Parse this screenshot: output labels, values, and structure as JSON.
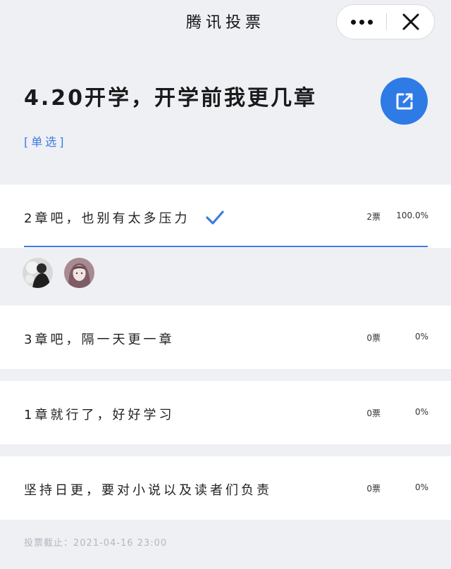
{
  "topbar": {
    "title": "腾讯投票"
  },
  "poll": {
    "title": "4.20开学，开学前我更几章",
    "type_label": "[单选]"
  },
  "options": [
    {
      "label": "2章吧，也别有太多压力",
      "votes": "2票",
      "percent": "100.0%",
      "fraction": 1.0,
      "selected": true
    },
    {
      "label": "3章吧，隔一天更一章",
      "votes": "0票",
      "percent": "0%",
      "fraction": 0,
      "selected": false
    },
    {
      "label": "1章就行了，好好学习",
      "votes": "0票",
      "percent": "0%",
      "fraction": 0,
      "selected": false
    },
    {
      "label": "坚持日更，要对小说以及读者们负责",
      "votes": "0票",
      "percent": "0%",
      "fraction": 0,
      "selected": false
    }
  ],
  "footer": {
    "deadline": "投票截止：2021-04-16 23:00"
  },
  "colors": {
    "accent": "#3b7be0",
    "fab": "#2e7be6",
    "background": "#eef0f4"
  },
  "icons": {
    "more": "more-dots-icon",
    "close": "close-icon",
    "share": "external-link-icon",
    "check": "checkmark-icon"
  }
}
